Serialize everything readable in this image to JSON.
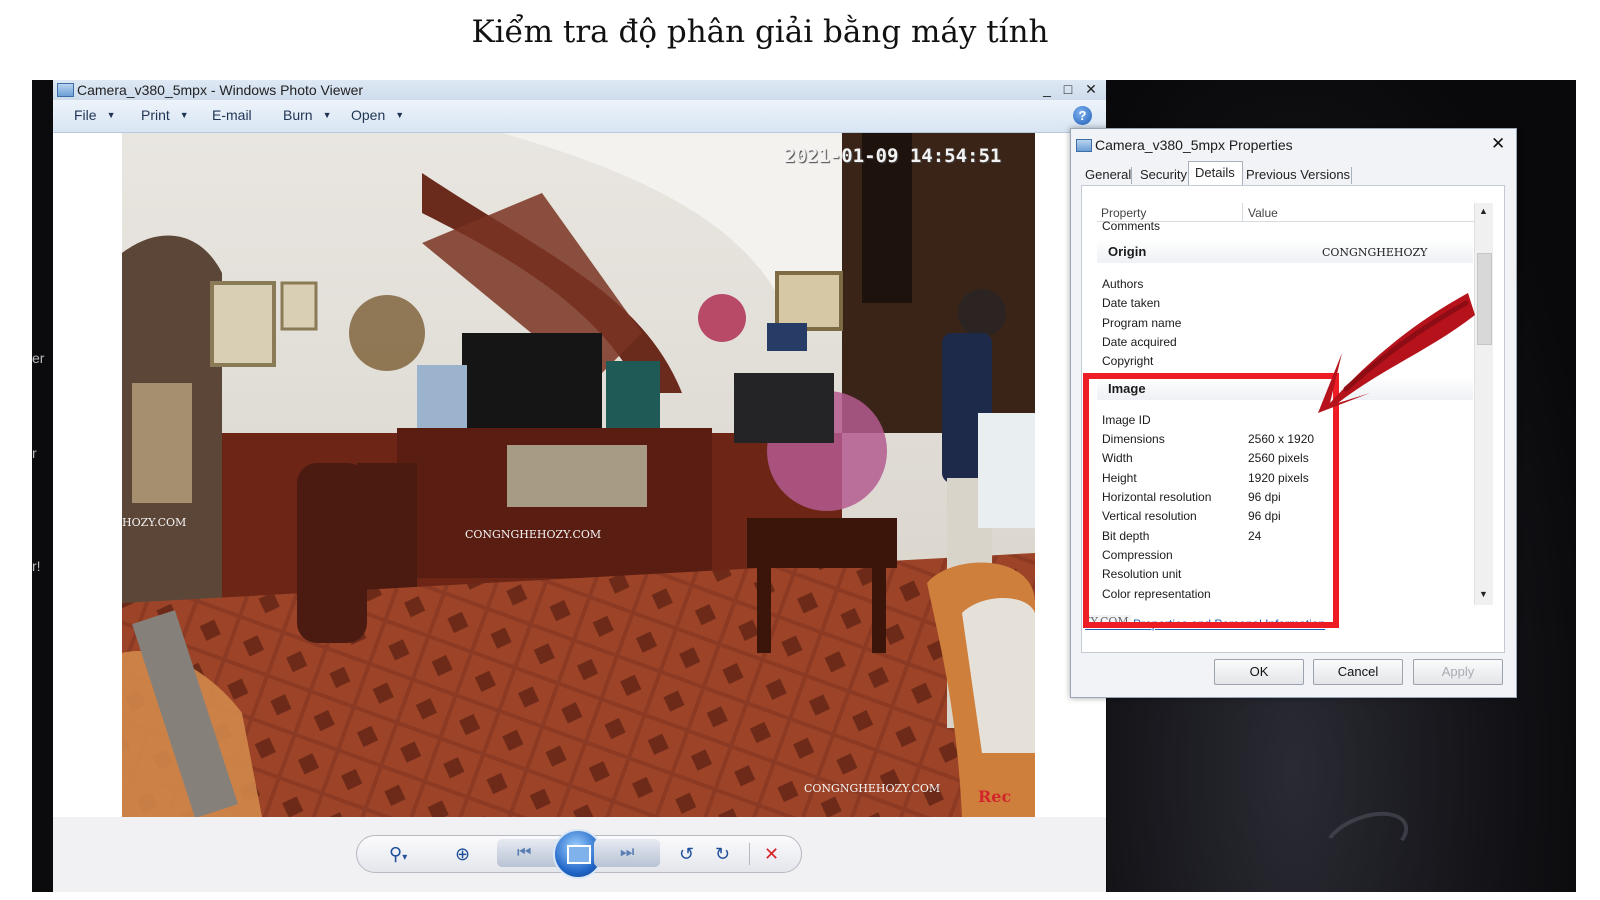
{
  "page_title": "Kiểm tra độ phân giải bằng máy tính",
  "desktop": {
    "edge_texts": [
      "er",
      "r",
      "r!"
    ]
  },
  "photo_viewer": {
    "title": "Camera_v380_5mpx - Windows Photo Viewer",
    "window_buttons": {
      "minimize": "_",
      "maximize": "□",
      "close": "✕"
    },
    "menu": [
      "File",
      "Print",
      "E-mail",
      "Burn",
      "Open"
    ],
    "menu_has_dropdown": [
      true,
      true,
      false,
      true,
      true
    ],
    "help_label": "?",
    "photo": {
      "timestamp": "2021-01-09 14:54:51",
      "watermark_center": "CONGNGHEHOZY.COM",
      "watermark_left": "HOZY.COM",
      "watermark_bottom": "CONGNGHEHOZY.COM",
      "rec_label": "Rec"
    },
    "controls": {
      "zoom": "⚲",
      "zoom_caret": "▾",
      "fit": "⊕",
      "previous": "⏮",
      "next": "⏭",
      "rotate_ccw": "↺",
      "rotate_cw": "↻",
      "delete": "✕"
    }
  },
  "properties_dialog": {
    "title": "Camera_v380_5mpx Properties",
    "close": "✕",
    "tabs": [
      "General",
      "Security",
      "Details",
      "Previous Versions"
    ],
    "active_tab": "Details",
    "columns": [
      "Property",
      "Value"
    ],
    "rows_top": [
      "Comments"
    ],
    "origin": {
      "header": "Origin",
      "header_value": "CONGNGHEHOZY",
      "rows": [
        "Authors",
        "Date taken",
        "Program name",
        "Date acquired",
        "Copyright"
      ]
    },
    "image": {
      "header": "Image",
      "rows": [
        {
          "property": "Image ID",
          "value": ""
        },
        {
          "property": "Dimensions",
          "value": "2560 x 1920"
        },
        {
          "property": "Width",
          "value": "2560 pixels"
        },
        {
          "property": "Height",
          "value": "1920 pixels"
        },
        {
          "property": "Horizontal resolution",
          "value": "96 dpi"
        },
        {
          "property": "Vertical resolution",
          "value": "96 dpi"
        },
        {
          "property": "Bit depth",
          "value": "24"
        },
        {
          "property": "Compression",
          "value": ""
        },
        {
          "property": "Resolution unit",
          "value": ""
        },
        {
          "property": "Color representation",
          "value": ""
        }
      ]
    },
    "link_text": "Remove Properties and Personal Information",
    "link_overlay": "ZY.COM",
    "buttons": {
      "ok": "OK",
      "cancel": "Cancel",
      "apply": "Apply"
    },
    "scroll_up": "▲",
    "scroll_down": "▼"
  },
  "annotation": {
    "highlight_color": "#ee1c24",
    "arrow_color": "#b5121b"
  }
}
